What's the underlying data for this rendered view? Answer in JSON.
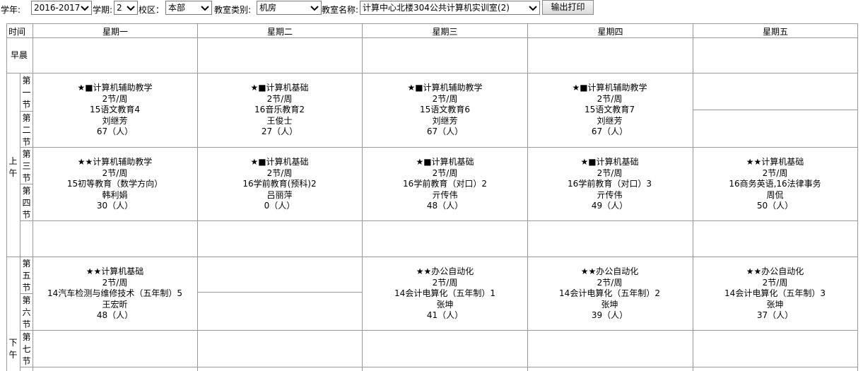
{
  "filters": {
    "year_label": "学年:",
    "year_value": "2016-2017",
    "term_label": "学期:",
    "term_value": "2",
    "campus_label": "校区：",
    "campus_value": "本部",
    "room_type_label": "教室类别:",
    "room_type_value": "机房",
    "room_name_label": "教室名称:",
    "room_name_value": "计算中心北楼304公共计算机实训室(2)",
    "print_button": "输出打印"
  },
  "header": {
    "time": "时间",
    "days": [
      "星期一",
      "星期二",
      "星期三",
      "星期四",
      "星期五"
    ]
  },
  "periods": {
    "morning_early": "早晨",
    "am": "上午",
    "pm": "下午",
    "p1": "第一节",
    "p2": "第二节",
    "p3": "第三节",
    "p4": "第四节",
    "p5": "第五节",
    "p6": "第六节",
    "p7": "第七节"
  },
  "block12": [
    {
      "course": "★■计算机辅助教学",
      "hours": "2节/周",
      "class": "15语文教育4",
      "teacher": "刘继芳",
      "count": "67（人）"
    },
    {
      "course": "★■计算机基础",
      "hours": "2节/周",
      "class": "16音乐教育2",
      "teacher": "王俊士",
      "count": "27（人）"
    },
    {
      "course": "★■计算机辅助教学",
      "hours": "2节/周",
      "class": "15语文教育6",
      "teacher": "刘继芳",
      "count": "67（人）"
    },
    {
      "course": "★■计算机辅助教学",
      "hours": "2节/周",
      "class": "15语文教育7",
      "teacher": "刘继芳",
      "count": "67（人）"
    }
  ],
  "block34": [
    {
      "course": "★★计算机辅助教学",
      "hours": "2节/周",
      "class": "15初等教育（数学方向）",
      "teacher": "韩利娟",
      "count": "30（人）"
    },
    {
      "course": "★■计算机基础",
      "hours": "2节/周",
      "class": "16学前教育(预科)2",
      "teacher": "吕丽萍",
      "count": "0（人）"
    },
    {
      "course": "★■计算机基础",
      "hours": "2节/周",
      "class": "16学前教育（对口）2",
      "teacher": "亓传伟",
      "count": "48（人）"
    },
    {
      "course": "★■计算机基础",
      "hours": "2节/周",
      "class": "16学前教育（对口）3",
      "teacher": "亓传伟",
      "count": "49（人）"
    },
    {
      "course": "★★计算机基础",
      "hours": "2节/周",
      "class": "16商务英语,16法律事务",
      "teacher": "周侃",
      "count": "50（人）"
    }
  ],
  "block56": [
    {
      "course": "★★计算机基础",
      "hours": "2节/周",
      "class": "14汽车检测与维修技术（五年制）5",
      "teacher": "王宏昕",
      "count": "48（人）"
    },
    {
      "course": "★★办公自动化",
      "hours": "2节/周",
      "class": "14会计电算化（五年制）1",
      "teacher": "张坤",
      "count": "41（人）"
    },
    {
      "course": "★★办公自动化",
      "hours": "2节/周",
      "class": "14会计电算化（五年制）2",
      "teacher": "张坤",
      "count": "39（人）"
    },
    {
      "course": "★★办公自动化",
      "hours": "2节/周",
      "class": "14会计电算化（五年制）3",
      "teacher": "张坤",
      "count": "37（人）"
    }
  ]
}
